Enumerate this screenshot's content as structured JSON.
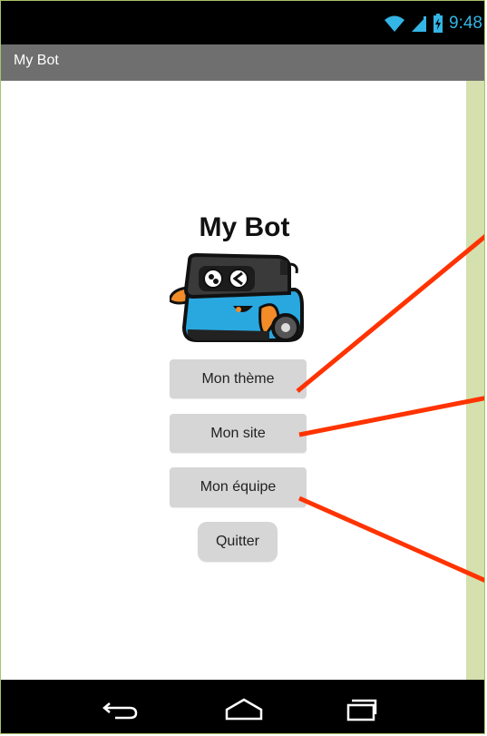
{
  "status_bar": {
    "time": "9:48",
    "time_color": "#33b5e5"
  },
  "title_bar": {
    "title": "My Bot"
  },
  "main": {
    "heading": "My Bot",
    "buttons": [
      {
        "label": "Mon thème"
      },
      {
        "label": "Mon site"
      },
      {
        "label": "Mon équipe"
      },
      {
        "label": "Quitter"
      }
    ]
  },
  "nav_bar": {
    "icons": [
      "back-icon",
      "home-icon",
      "recents-icon"
    ]
  },
  "annotation_color": "#ff3300",
  "accent_green": "#d4e0ad"
}
